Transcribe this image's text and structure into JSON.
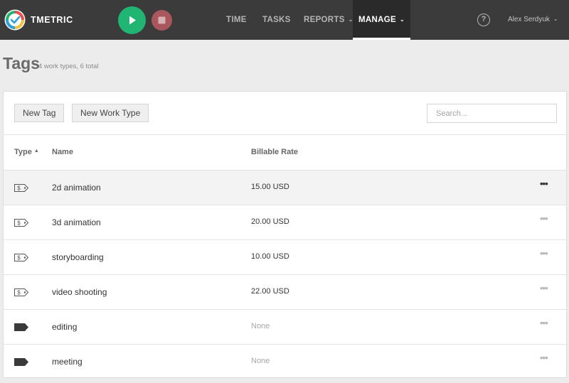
{
  "header": {
    "brand": "TMETRIC",
    "nav": [
      {
        "label": "TIME"
      },
      {
        "label": "TASKS"
      },
      {
        "label": "REPORTS"
      },
      {
        "label": "MANAGE"
      }
    ],
    "help_glyph": "?",
    "user_name": "Alex Serdyuk",
    "colors": {
      "bar": "#3b3b3b",
      "start": "#20b573",
      "stop": "#a8575c"
    }
  },
  "page": {
    "title": "Tags",
    "subtitle": "4 work types, 6 total"
  },
  "toolbar": {
    "new_tag_label": "New Tag",
    "new_work_type_label": "New Work Type",
    "search_placeholder": "Search..."
  },
  "table": {
    "columns": {
      "type": "Type",
      "name": "Name",
      "rate": "Billable Rate"
    },
    "more_glyph": "•••",
    "rows": [
      {
        "icon": "work-type-icon",
        "name": "2d animation",
        "rate": "15.00 USD"
      },
      {
        "icon": "work-type-icon",
        "name": "3d animation",
        "rate": "20.00 USD"
      },
      {
        "icon": "work-type-icon",
        "name": "storyboarding",
        "rate": "10.00 USD"
      },
      {
        "icon": "work-type-icon",
        "name": "video shooting",
        "rate": "22.00 USD"
      },
      {
        "icon": "tag-icon",
        "name": "editing",
        "rate": "None"
      },
      {
        "icon": "tag-icon",
        "name": "meeting",
        "rate": "None"
      }
    ]
  }
}
